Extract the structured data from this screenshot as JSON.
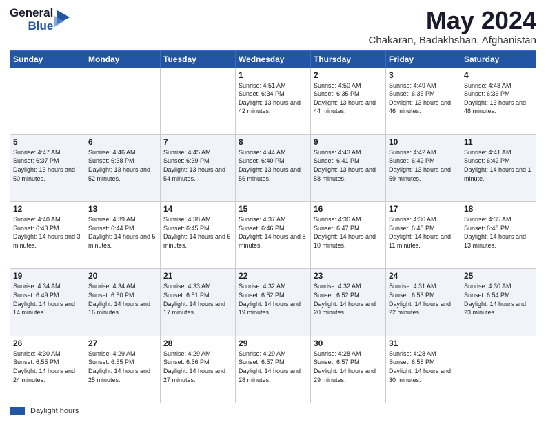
{
  "header": {
    "logo_general": "General",
    "logo_blue": "Blue",
    "month_title": "May 2024",
    "location": "Chakaran, Badakhshan, Afghanistan"
  },
  "weekdays": [
    "Sunday",
    "Monday",
    "Tuesday",
    "Wednesday",
    "Thursday",
    "Friday",
    "Saturday"
  ],
  "footer": {
    "daylight_label": "Daylight hours"
  },
  "weeks": [
    [
      {
        "day": "",
        "sunrise": "",
        "sunset": "",
        "daylight": ""
      },
      {
        "day": "",
        "sunrise": "",
        "sunset": "",
        "daylight": ""
      },
      {
        "day": "",
        "sunrise": "",
        "sunset": "",
        "daylight": ""
      },
      {
        "day": "1",
        "sunrise": "Sunrise: 4:51 AM",
        "sunset": "Sunset: 6:34 PM",
        "daylight": "Daylight: 13 hours and 42 minutes."
      },
      {
        "day": "2",
        "sunrise": "Sunrise: 4:50 AM",
        "sunset": "Sunset: 6:35 PM",
        "daylight": "Daylight: 13 hours and 44 minutes."
      },
      {
        "day": "3",
        "sunrise": "Sunrise: 4:49 AM",
        "sunset": "Sunset: 6:35 PM",
        "daylight": "Daylight: 13 hours and 46 minutes."
      },
      {
        "day": "4",
        "sunrise": "Sunrise: 4:48 AM",
        "sunset": "Sunset: 6:36 PM",
        "daylight": "Daylight: 13 hours and 48 minutes."
      }
    ],
    [
      {
        "day": "5",
        "sunrise": "Sunrise: 4:47 AM",
        "sunset": "Sunset: 6:37 PM",
        "daylight": "Daylight: 13 hours and 50 minutes."
      },
      {
        "day": "6",
        "sunrise": "Sunrise: 4:46 AM",
        "sunset": "Sunset: 6:38 PM",
        "daylight": "Daylight: 13 hours and 52 minutes."
      },
      {
        "day": "7",
        "sunrise": "Sunrise: 4:45 AM",
        "sunset": "Sunset: 6:39 PM",
        "daylight": "Daylight: 13 hours and 54 minutes."
      },
      {
        "day": "8",
        "sunrise": "Sunrise: 4:44 AM",
        "sunset": "Sunset: 6:40 PM",
        "daylight": "Daylight: 13 hours and 56 minutes."
      },
      {
        "day": "9",
        "sunrise": "Sunrise: 4:43 AM",
        "sunset": "Sunset: 6:41 PM",
        "daylight": "Daylight: 13 hours and 58 minutes."
      },
      {
        "day": "10",
        "sunrise": "Sunrise: 4:42 AM",
        "sunset": "Sunset: 6:42 PM",
        "daylight": "Daylight: 13 hours and 59 minutes."
      },
      {
        "day": "11",
        "sunrise": "Sunrise: 4:41 AM",
        "sunset": "Sunset: 6:42 PM",
        "daylight": "Daylight: 14 hours and 1 minute."
      }
    ],
    [
      {
        "day": "12",
        "sunrise": "Sunrise: 4:40 AM",
        "sunset": "Sunset: 6:43 PM",
        "daylight": "Daylight: 14 hours and 3 minutes."
      },
      {
        "day": "13",
        "sunrise": "Sunrise: 4:39 AM",
        "sunset": "Sunset: 6:44 PM",
        "daylight": "Daylight: 14 hours and 5 minutes."
      },
      {
        "day": "14",
        "sunrise": "Sunrise: 4:38 AM",
        "sunset": "Sunset: 6:45 PM",
        "daylight": "Daylight: 14 hours and 6 minutes."
      },
      {
        "day": "15",
        "sunrise": "Sunrise: 4:37 AM",
        "sunset": "Sunset: 6:46 PM",
        "daylight": "Daylight: 14 hours and 8 minutes."
      },
      {
        "day": "16",
        "sunrise": "Sunrise: 4:36 AM",
        "sunset": "Sunset: 6:47 PM",
        "daylight": "Daylight: 14 hours and 10 minutes."
      },
      {
        "day": "17",
        "sunrise": "Sunrise: 4:36 AM",
        "sunset": "Sunset: 6:48 PM",
        "daylight": "Daylight: 14 hours and 11 minutes."
      },
      {
        "day": "18",
        "sunrise": "Sunrise: 4:35 AM",
        "sunset": "Sunset: 6:48 PM",
        "daylight": "Daylight: 14 hours and 13 minutes."
      }
    ],
    [
      {
        "day": "19",
        "sunrise": "Sunrise: 4:34 AM",
        "sunset": "Sunset: 6:49 PM",
        "daylight": "Daylight: 14 hours and 14 minutes."
      },
      {
        "day": "20",
        "sunrise": "Sunrise: 4:34 AM",
        "sunset": "Sunset: 6:50 PM",
        "daylight": "Daylight: 14 hours and 16 minutes."
      },
      {
        "day": "21",
        "sunrise": "Sunrise: 4:33 AM",
        "sunset": "Sunset: 6:51 PM",
        "daylight": "Daylight: 14 hours and 17 minutes."
      },
      {
        "day": "22",
        "sunrise": "Sunrise: 4:32 AM",
        "sunset": "Sunset: 6:52 PM",
        "daylight": "Daylight: 14 hours and 19 minutes."
      },
      {
        "day": "23",
        "sunrise": "Sunrise: 4:32 AM",
        "sunset": "Sunset: 6:52 PM",
        "daylight": "Daylight: 14 hours and 20 minutes."
      },
      {
        "day": "24",
        "sunrise": "Sunrise: 4:31 AM",
        "sunset": "Sunset: 6:53 PM",
        "daylight": "Daylight: 14 hours and 22 minutes."
      },
      {
        "day": "25",
        "sunrise": "Sunrise: 4:30 AM",
        "sunset": "Sunset: 6:54 PM",
        "daylight": "Daylight: 14 hours and 23 minutes."
      }
    ],
    [
      {
        "day": "26",
        "sunrise": "Sunrise: 4:30 AM",
        "sunset": "Sunset: 6:55 PM",
        "daylight": "Daylight: 14 hours and 24 minutes."
      },
      {
        "day": "27",
        "sunrise": "Sunrise: 4:29 AM",
        "sunset": "Sunset: 6:55 PM",
        "daylight": "Daylight: 14 hours and 25 minutes."
      },
      {
        "day": "28",
        "sunrise": "Sunrise: 4:29 AM",
        "sunset": "Sunset: 6:56 PM",
        "daylight": "Daylight: 14 hours and 27 minutes."
      },
      {
        "day": "29",
        "sunrise": "Sunrise: 4:29 AM",
        "sunset": "Sunset: 6:57 PM",
        "daylight": "Daylight: 14 hours and 28 minutes."
      },
      {
        "day": "30",
        "sunrise": "Sunrise: 4:28 AM",
        "sunset": "Sunset: 6:57 PM",
        "daylight": "Daylight: 14 hours and 29 minutes."
      },
      {
        "day": "31",
        "sunrise": "Sunrise: 4:28 AM",
        "sunset": "Sunset: 6:58 PM",
        "daylight": "Daylight: 14 hours and 30 minutes."
      },
      {
        "day": "",
        "sunrise": "",
        "sunset": "",
        "daylight": ""
      }
    ]
  ]
}
